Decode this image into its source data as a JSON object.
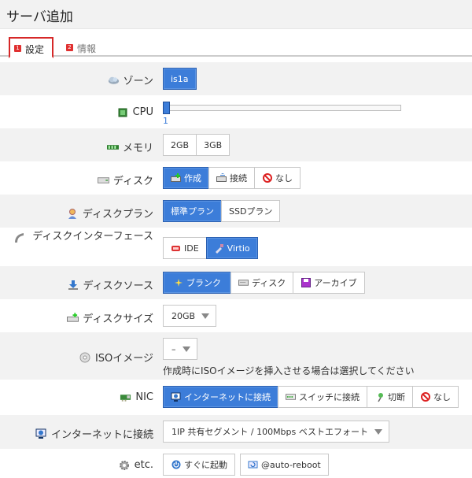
{
  "page": {
    "title": "サーバ追加"
  },
  "tabs": [
    {
      "num": "1",
      "label": "設定"
    },
    {
      "num": "2",
      "label": "情報"
    }
  ],
  "zone": {
    "label": "ゾーン",
    "options": [
      "is1a"
    ],
    "selected": "is1a"
  },
  "cpu": {
    "label": "CPU",
    "value": "1",
    "level_fraction": 0
  },
  "memory": {
    "label": "メモリ",
    "options": [
      "2GB",
      "3GB"
    ]
  },
  "disk": {
    "label": "ディスク",
    "options": [
      "作成",
      "接続",
      "なし"
    ],
    "selected": "作成"
  },
  "disk_plan": {
    "label": "ディスクプラン",
    "options": [
      "標準プラン",
      "SSDプラン"
    ],
    "selected": "標準プラン"
  },
  "disk_interface": {
    "label": "ディスクインターフェース",
    "options": [
      "IDE",
      "Virtio"
    ],
    "selected": "Virtio"
  },
  "disk_source": {
    "label": "ディスクソース",
    "options": [
      "ブランク",
      "ディスク",
      "アーカイブ"
    ],
    "selected": "ブランク"
  },
  "disk_size": {
    "label": "ディスクサイズ",
    "value": "20GB"
  },
  "iso": {
    "label": "ISOイメージ",
    "value": "–",
    "hint": "作成時にISOイメージを挿入させる場合は選択してください"
  },
  "nic": {
    "label": "NIC",
    "options": [
      "インターネットに接続",
      "スイッチに接続",
      "切断",
      "なし"
    ],
    "selected": "インターネットに接続"
  },
  "internet": {
    "label": "インターネットに接続",
    "value": "1IP 共有セグメント / 100Mbps ベストエフォート"
  },
  "etc": {
    "label": "etc.",
    "options": [
      "すぐに起動",
      "@auto-reboot"
    ]
  },
  "colors": {
    "accent": "#3c7dd9",
    "tab_border": "#d62828",
    "row_alt": "#f2f2f2"
  }
}
